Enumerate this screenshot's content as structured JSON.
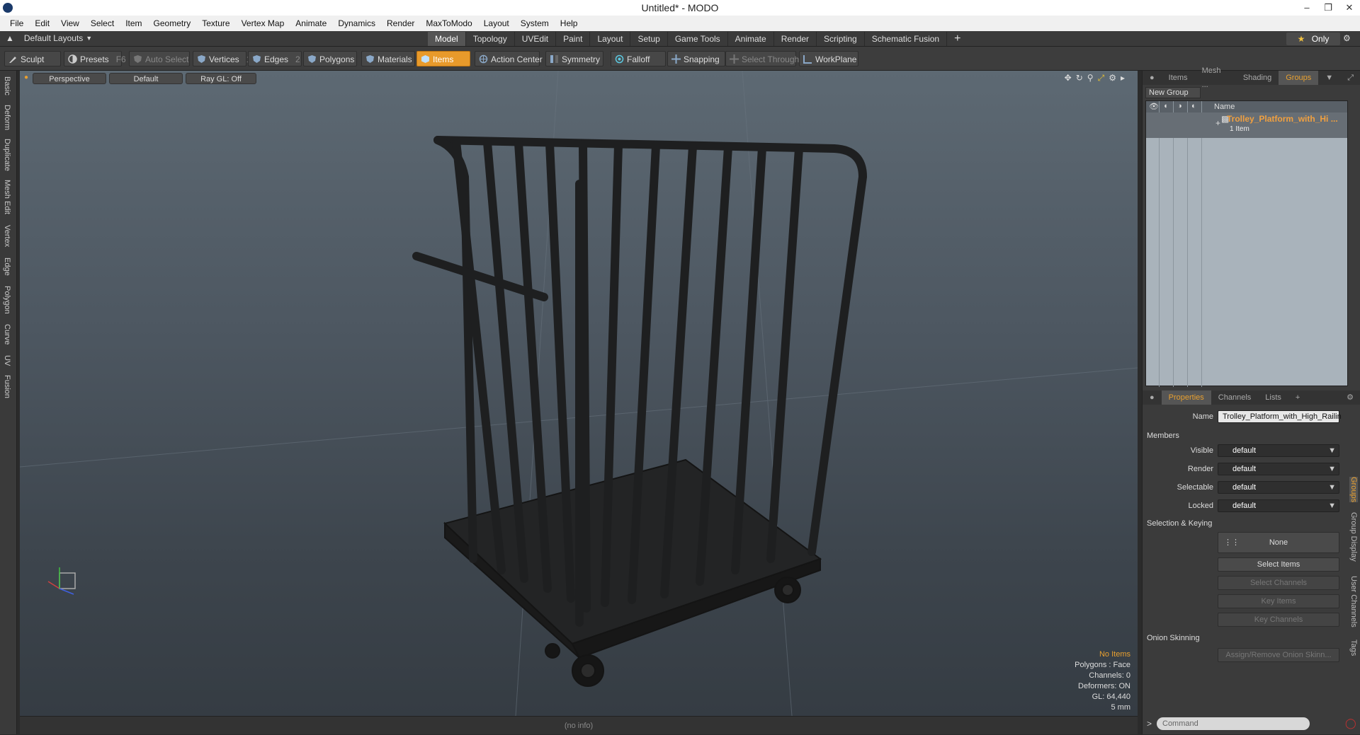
{
  "window": {
    "title": "Untitled* - MODO"
  },
  "menu": [
    "File",
    "Edit",
    "View",
    "Select",
    "Item",
    "Geometry",
    "Texture",
    "Vertex Map",
    "Animate",
    "Dynamics",
    "Render",
    "MaxToModo",
    "Layout",
    "System",
    "Help"
  ],
  "layout_switcher": "Default Layouts",
  "tabs": [
    "Model",
    "Topology",
    "UVEdit",
    "Paint",
    "Layout",
    "Setup",
    "Game Tools",
    "Animate",
    "Render",
    "Scripting",
    "Schematic Fusion"
  ],
  "active_tab": "Model",
  "only_label": "Only",
  "toolbar": {
    "sculpt": "Sculpt",
    "presets": "Presets",
    "presets_key": "F6",
    "auto_select": "Auto Select",
    "vertices": "Vertices",
    "vertices_num": "1",
    "edges": "Edges",
    "edges_num": "2",
    "polygons": "Polygons",
    "materials": "Materials",
    "items": "Items",
    "action_center": "Action Center",
    "symmetry": "Symmetry",
    "falloff": "Falloff",
    "snapping": "Snapping",
    "select_through": "Select Through",
    "workplane": "WorkPlane"
  },
  "left_tabs": [
    "Basic",
    "Deform",
    "Duplicate",
    "Mesh Edit",
    "Vertex",
    "Edge",
    "Polygon",
    "Curve",
    "UV",
    "Fusion"
  ],
  "viewport": {
    "view": "Perspective",
    "shading": "Default",
    "raygl": "Ray GL: Off",
    "stats": {
      "items": "No Items",
      "polygons": "Polygons : Face",
      "channels": "Channels: 0",
      "deformers": "Deformers: ON",
      "gl": "GL: 64,440",
      "scale": "5 mm"
    }
  },
  "status": "(no info)",
  "right_top_tabs": [
    "Items",
    "Mesh ...",
    "Shading",
    "Groups"
  ],
  "active_right_tab": "Groups",
  "groups": {
    "new_group": "New Group",
    "col_name": "Name",
    "item_name": "Trolley_Platform_with_Hi ...",
    "item_sub": "1 Item"
  },
  "props_tabs": [
    "Properties",
    "Channels",
    "Lists"
  ],
  "properties": {
    "name_label": "Name",
    "name_value": "Trolley_Platform_with_High_Railin",
    "members": "Members",
    "visible_label": "Visible",
    "visible_value": "default",
    "render_label": "Render",
    "render_value": "default",
    "selectable_label": "Selectable",
    "selectable_value": "default",
    "locked_label": "Locked",
    "locked_value": "default",
    "selection_keying": "Selection & Keying",
    "none_label": "None",
    "select_items": "Select Items",
    "select_channels": "Select Channels",
    "key_items": "Key Items",
    "key_channels": "Key Channels",
    "onion": "Onion Skinning",
    "assign_onion": "Assign/Remove Onion Skinn..."
  },
  "side_tabs": [
    "Groups",
    "Group Display",
    "User Channels",
    "Tags"
  ],
  "command_placeholder": "Command",
  "colors": {
    "accent": "#e89a2b",
    "name_orange": "#f0a040"
  }
}
